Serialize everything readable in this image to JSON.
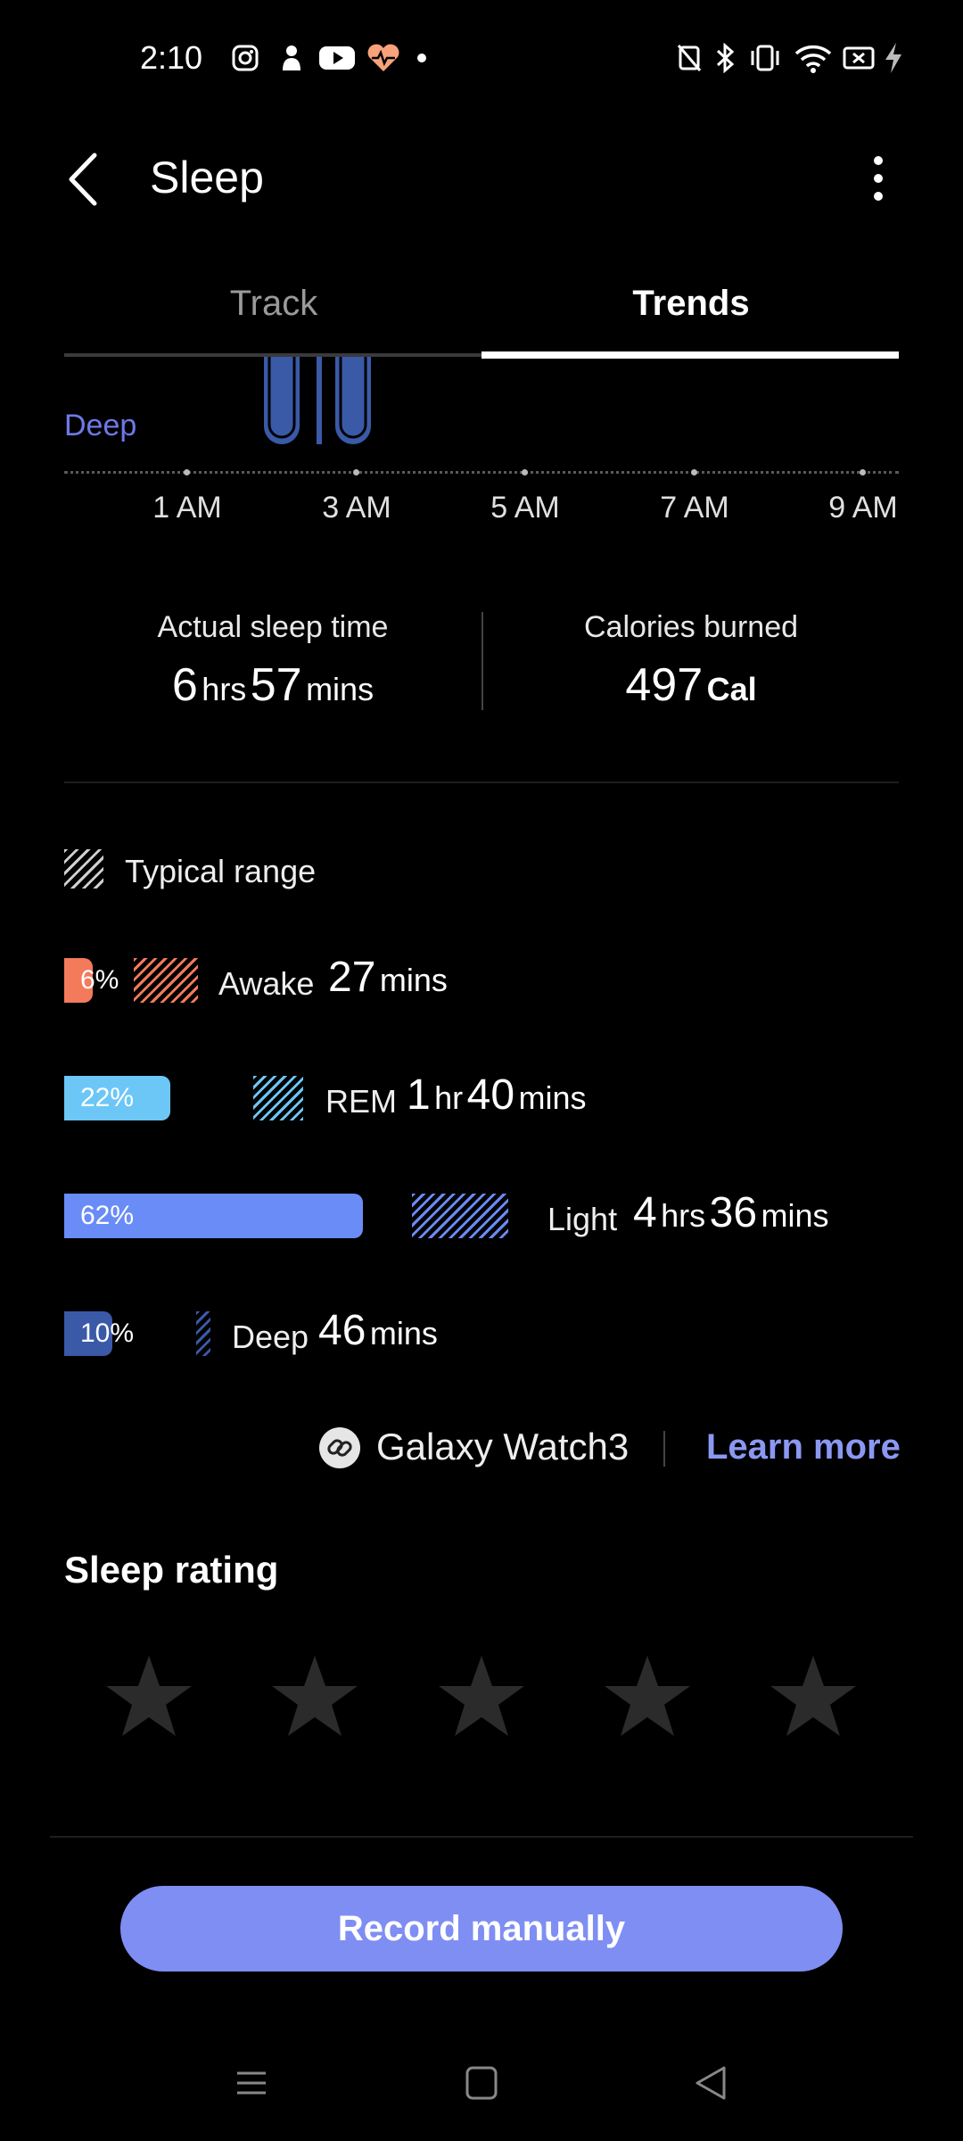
{
  "status_bar": {
    "time": "2:10",
    "left_icons": [
      "instagram-icon",
      "app-icon",
      "youtube-icon",
      "health-icon",
      "dot-icon"
    ],
    "right_icons": [
      "nfc-icon",
      "bluetooth-icon",
      "vibrate-icon",
      "wifi-icon",
      "battery-saver-icon",
      "charging-icon"
    ]
  },
  "header": {
    "title": "Sleep"
  },
  "tabs": [
    {
      "label": "Track",
      "selected": false
    },
    {
      "label": "Trends",
      "selected": true
    }
  ],
  "chart": {
    "partial_label": "Deep",
    "time_ticks": [
      "1 AM",
      "3 AM",
      "5 AM",
      "7 AM",
      "9 AM"
    ]
  },
  "summary": {
    "sleep_time_label": "Actual sleep time",
    "sleep_hrs": "6",
    "sleep_hrs_unit": "hrs",
    "sleep_mins": "57",
    "sleep_mins_unit": "mins",
    "calories_label": "Calories burned",
    "calories_value": "497",
    "calories_unit": "Cal"
  },
  "legend": {
    "typical_range": "Typical range"
  },
  "stages": [
    {
      "name": "Awake",
      "percent": "6%",
      "fraction": 0.06,
      "color": "#f47a5c",
      "num1": "27",
      "unit1": "mins",
      "num2": "",
      "unit2": ""
    },
    {
      "name": "REM",
      "percent": "22%",
      "fraction": 0.22,
      "color": "#6cc7f7",
      "num1": "1",
      "unit1": "hr",
      "num2": "40",
      "unit2": "mins"
    },
    {
      "name": "Light",
      "percent": "62%",
      "fraction": 0.62,
      "color": "#6a8cf6",
      "num1": "4",
      "unit1": "hrs",
      "num2": "36",
      "unit2": "mins"
    },
    {
      "name": "Deep",
      "percent": "10%",
      "fraction": 0.1,
      "color": "#3a5aa8",
      "num1": "46",
      "unit1": "mins",
      "num2": "",
      "unit2": ""
    }
  ],
  "device": {
    "name": "Galaxy Watch3",
    "learn_more": "Learn more"
  },
  "rating": {
    "title": "Sleep rating",
    "stars_filled": 0,
    "stars_total": 5
  },
  "record_button": "Record manually",
  "nav_icons": [
    "menu-icon",
    "home-icon",
    "back-icon"
  ],
  "colors": {
    "accent": "#7f8ef3",
    "deep": "#3a5aa8",
    "link": "#8b98f2"
  }
}
